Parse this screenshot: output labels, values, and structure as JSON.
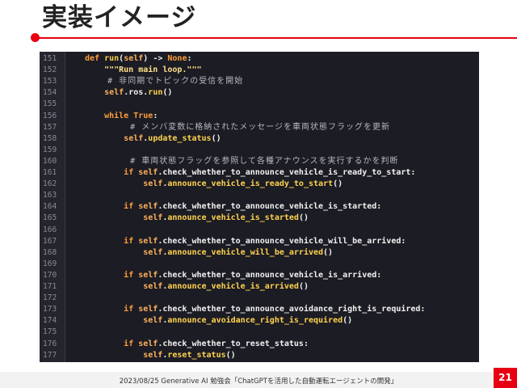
{
  "slide": {
    "title": "実装イメージ",
    "accent_color": "#e60012",
    "footer": "2023/08/25 Generative AI 勉強会「ChatGPTを活用した自動運転エージェントの開発」",
    "page_number": "21"
  },
  "code": {
    "background": "#1c1c24",
    "lines": [
      {
        "n": "151",
        "tokens": [
          {
            "t": "def ",
            "c": "kw"
          },
          {
            "t": "run",
            "c": "fn"
          },
          {
            "t": "(",
            "c": ""
          },
          {
            "t": "self",
            "c": "slf"
          },
          {
            "t": ") -> ",
            "c": ""
          },
          {
            "t": "None",
            "c": "kw"
          },
          {
            "t": ":",
            "c": ""
          }
        ]
      },
      {
        "n": "152",
        "tokens": [
          {
            "t": "    \"\"\"Run main loop.\"\"\"",
            "c": "str"
          }
        ]
      },
      {
        "n": "153",
        "tokens": [
          {
            "t": "    # 非同期でトピックの受信を開始",
            "c": "cm"
          }
        ]
      },
      {
        "n": "154",
        "tokens": [
          {
            "t": "    ",
            "c": ""
          },
          {
            "t": "self",
            "c": "slf"
          },
          {
            "t": ".ros.",
            "c": ""
          },
          {
            "t": "run",
            "c": "attr"
          },
          {
            "t": "()",
            "c": ""
          }
        ]
      },
      {
        "n": "155",
        "tokens": []
      },
      {
        "n": "156",
        "tokens": [
          {
            "t": "    ",
            "c": ""
          },
          {
            "t": "while ",
            "c": "kw"
          },
          {
            "t": "True",
            "c": "kw"
          },
          {
            "t": ":",
            "c": ""
          }
        ]
      },
      {
        "n": "157",
        "tokens": [
          {
            "t": "        # メンバ変数に格納されたメッセージを車両状態フラッグを更新",
            "c": "cm"
          }
        ]
      },
      {
        "n": "158",
        "tokens": [
          {
            "t": "        ",
            "c": ""
          },
          {
            "t": "self",
            "c": "slf"
          },
          {
            "t": ".",
            "c": ""
          },
          {
            "t": "update_status",
            "c": "attr"
          },
          {
            "t": "()",
            "c": ""
          }
        ]
      },
      {
        "n": "159",
        "tokens": []
      },
      {
        "n": "160",
        "tokens": [
          {
            "t": "        # 車両状態フラッグを参照して各種アナウンスを実行するかを判断",
            "c": "cm"
          }
        ]
      },
      {
        "n": "161",
        "tokens": [
          {
            "t": "        ",
            "c": ""
          },
          {
            "t": "if ",
            "c": "kw"
          },
          {
            "t": "self",
            "c": "slf"
          },
          {
            "t": ".check_whether_to_announce_vehicle_is_ready_to_start:",
            "c": ""
          }
        ]
      },
      {
        "n": "162",
        "tokens": [
          {
            "t": "            ",
            "c": ""
          },
          {
            "t": "self",
            "c": "slf"
          },
          {
            "t": ".",
            "c": ""
          },
          {
            "t": "announce_vehicle_is_ready_to_start",
            "c": "attr"
          },
          {
            "t": "()",
            "c": ""
          }
        ]
      },
      {
        "n": "163",
        "tokens": []
      },
      {
        "n": "164",
        "tokens": [
          {
            "t": "        ",
            "c": ""
          },
          {
            "t": "if ",
            "c": "kw"
          },
          {
            "t": "self",
            "c": "slf"
          },
          {
            "t": ".check_whether_to_announce_vehicle_is_started:",
            "c": ""
          }
        ]
      },
      {
        "n": "165",
        "tokens": [
          {
            "t": "            ",
            "c": ""
          },
          {
            "t": "self",
            "c": "slf"
          },
          {
            "t": ".",
            "c": ""
          },
          {
            "t": "announce_vehicle_is_started",
            "c": "attr"
          },
          {
            "t": "()",
            "c": ""
          }
        ]
      },
      {
        "n": "166",
        "tokens": []
      },
      {
        "n": "167",
        "tokens": [
          {
            "t": "        ",
            "c": ""
          },
          {
            "t": "if ",
            "c": "kw"
          },
          {
            "t": "self",
            "c": "slf"
          },
          {
            "t": ".check_whether_to_announce_vehicle_will_be_arrived:",
            "c": ""
          }
        ]
      },
      {
        "n": "168",
        "tokens": [
          {
            "t": "            ",
            "c": ""
          },
          {
            "t": "self",
            "c": "slf"
          },
          {
            "t": ".",
            "c": ""
          },
          {
            "t": "announce_vehicle_will_be_arrived",
            "c": "attr"
          },
          {
            "t": "()",
            "c": ""
          }
        ]
      },
      {
        "n": "169",
        "tokens": []
      },
      {
        "n": "170",
        "tokens": [
          {
            "t": "        ",
            "c": ""
          },
          {
            "t": "if ",
            "c": "kw"
          },
          {
            "t": "self",
            "c": "slf"
          },
          {
            "t": ".check_whether_to_announce_vehicle_is_arrived:",
            "c": ""
          }
        ]
      },
      {
        "n": "171",
        "tokens": [
          {
            "t": "            ",
            "c": ""
          },
          {
            "t": "self",
            "c": "slf"
          },
          {
            "t": ".",
            "c": ""
          },
          {
            "t": "announce_vehicle_is_arrived",
            "c": "attr"
          },
          {
            "t": "()",
            "c": ""
          }
        ]
      },
      {
        "n": "172",
        "tokens": []
      },
      {
        "n": "173",
        "tokens": [
          {
            "t": "        ",
            "c": ""
          },
          {
            "t": "if ",
            "c": "kw"
          },
          {
            "t": "self",
            "c": "slf"
          },
          {
            "t": ".check_whether_to_announce_avoidance_right_is_required:",
            "c": ""
          }
        ]
      },
      {
        "n": "174",
        "tokens": [
          {
            "t": "            ",
            "c": ""
          },
          {
            "t": "self",
            "c": "slf"
          },
          {
            "t": ".",
            "c": ""
          },
          {
            "t": "announce_avoidance_right_is_required",
            "c": "attr"
          },
          {
            "t": "()",
            "c": ""
          }
        ]
      },
      {
        "n": "175",
        "tokens": []
      },
      {
        "n": "176",
        "tokens": [
          {
            "t": "        ",
            "c": ""
          },
          {
            "t": "if ",
            "c": "kw"
          },
          {
            "t": "self",
            "c": "slf"
          },
          {
            "t": ".check_whether_to_reset_status:",
            "c": ""
          }
        ]
      },
      {
        "n": "177",
        "tokens": [
          {
            "t": "            ",
            "c": ""
          },
          {
            "t": "self",
            "c": "slf"
          },
          {
            "t": ".",
            "c": ""
          },
          {
            "t": "reset_status",
            "c": "attr"
          },
          {
            "t": "()",
            "c": ""
          }
        ]
      }
    ]
  }
}
